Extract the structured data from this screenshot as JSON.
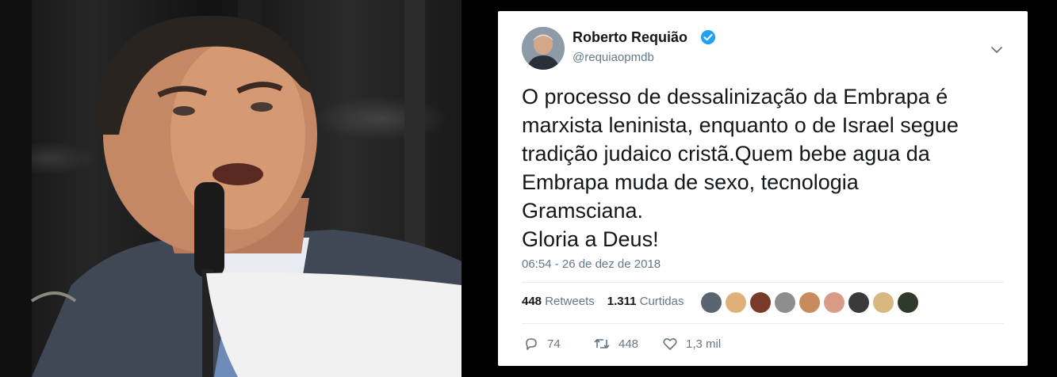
{
  "tweet": {
    "display_name": "Roberto Requião",
    "handle": "@requiaopmdb",
    "verified_icon": "verified-badge-icon",
    "text": "O processo de dessalinização da Embrapa é\nmarxista leninista, enquanto o de Israel segue\ntradição judaico cristã.Quem bebe agua da\nEmbrapa muda de sexo, tecnologia\nGramsciana.\nGloria a Deus!",
    "timestamp": "06:54 - 26 de dez de 2018",
    "stats": {
      "retweets_count": "448",
      "retweets_label": "Retweets",
      "likes_count": "1.311",
      "likes_label": "Curtidas"
    },
    "actions": {
      "replies": "74",
      "retweets": "448",
      "likes": "1,3 mil"
    },
    "liker_avatar_colors": [
      "#5a6470",
      "#e0b07a",
      "#7a3a2a",
      "#8e8e8e",
      "#c98b5e",
      "#d99a86",
      "#3a3a3a",
      "#d8b880",
      "#2f3a2a"
    ]
  },
  "colors": {
    "verified_blue": "#1da1f2",
    "text_primary": "#14171a",
    "text_secondary": "#657786"
  }
}
